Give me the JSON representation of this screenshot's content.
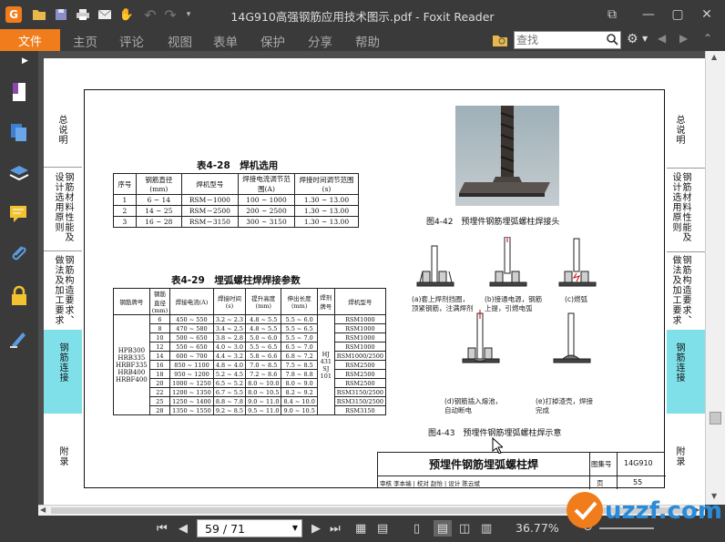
{
  "app": {
    "title": "14G910高强钢筋应用技术图示.pdf - Foxit Reader",
    "colors": {
      "accent": "#f07c1c",
      "chrome": "#3a3a3a",
      "highlight_tab": "#7fe0ea"
    }
  },
  "quick_access": {
    "icons": [
      "foxit-logo-icon",
      "open-folder-icon",
      "save-icon",
      "print-icon",
      "email-icon",
      "hand-tool-icon",
      "undo-icon",
      "redo-icon",
      "customize-icon"
    ]
  },
  "window_controls": {
    "icons": [
      "restore-icon",
      "minimize-icon",
      "maximize-icon",
      "close-icon"
    ]
  },
  "menu": {
    "file": "文件",
    "tabs": [
      "主页",
      "评论",
      "视图",
      "表单",
      "保护",
      "分享",
      "帮助"
    ],
    "search_placeholder": "查找"
  },
  "sidebar": {
    "icons": [
      "expand-panel-icon",
      "bookmark-icon",
      "pages-icon",
      "layers-icon",
      "comments-icon",
      "attachments-icon",
      "security-icon",
      "signature-icon"
    ]
  },
  "document": {
    "left_tabs": [
      "总说明",
      "钢筋材料性能及设计选用原则",
      "钢筋构造要求、做法及加工要求",
      "钢筋连接",
      "附录"
    ],
    "right_tabs": [
      "总说明",
      "钢筋材料性能及设计选用原则",
      "钢筋构造要求、做法及加工要求",
      "钢筋连接",
      "附录"
    ],
    "table28": {
      "caption": "表4-28　焊机选用",
      "headers": [
        "序号",
        "钢筋直径(mm)",
        "焊机型号",
        "焊接电流调节范围(A)",
        "焊接时间调节范围(s)"
      ],
      "rows": [
        [
          "1",
          "6 ~ 14",
          "RSM－1000",
          "100 ~ 1000",
          "1.30 ~ 13.00"
        ],
        [
          "2",
          "14 ~ 25",
          "RSM－2500",
          "200 ~ 2500",
          "1.30 ~ 13.00"
        ],
        [
          "3",
          "16 ~ 28",
          "RSM－3150",
          "300 ~ 3150",
          "1.30 ~ 13.00"
        ]
      ]
    },
    "table29": {
      "caption": "表4-29　埋弧螺柱焊焊接参数",
      "headers": [
        "钢筋牌号",
        "钢筋直径(mm)",
        "焊接电流(A)",
        "焊接时间(s)",
        "提升高度(mm)",
        "伸出长度(mm)",
        "焊剂牌号",
        "焊机型号"
      ],
      "grades": "HPB300 HRB335 HRBF335 HRB400 HRBF400",
      "flux": "HJ 431 SJ 101",
      "rows": [
        [
          "6",
          "450 ~ 550",
          "3.2 ~ 2.3",
          "4.8 ~ 5.5",
          "5.5 ~ 6.0",
          "RSM1000"
        ],
        [
          "8",
          "470 ~ 580",
          "3.4 ~ 2.5",
          "4.8 ~ 5.5",
          "5.5 ~ 6.5",
          "RSM1000"
        ],
        [
          "10",
          "500 ~ 650",
          "3.8 ~ 2.8",
          "5.0 ~ 6.0",
          "5.5 ~ 7.0",
          "RSM1000"
        ],
        [
          "12",
          "550 ~ 650",
          "4.0 ~ 3.0",
          "5.5 ~ 6.5",
          "6.5 ~ 7.0",
          "RSM1000"
        ],
        [
          "14",
          "600 ~ 700",
          "4.4 ~ 3.2",
          "5.8 ~ 6.6",
          "6.8 ~ 7.2",
          "RSM1000/2500"
        ],
        [
          "16",
          "850 ~ 1100",
          "4.8 ~ 4.0",
          "7.0 ~ 8.5",
          "7.5 ~ 8.5",
          "RSM2500"
        ],
        [
          "18",
          "950 ~ 1200",
          "5.2 ~ 4.5",
          "7.2 ~ 8.6",
          "7.8 ~ 8.8",
          "RSM2500"
        ],
        [
          "20",
          "1000 ~ 1250",
          "6.5 ~ 5.2",
          "8.0 ~ 10.0",
          "8.0 ~ 9.0",
          "RSM2500"
        ],
        [
          "22",
          "1200 ~ 1350",
          "6.7 ~ 5.5",
          "8.0 ~ 10.5",
          "8.2 ~ 9.2",
          "RSM3150/2500"
        ],
        [
          "25",
          "1250 ~ 1400",
          "8.8 ~ 7.8",
          "9.0 ~ 11.0",
          "8.4 ~ 10.0",
          "RSM3150/2500"
        ],
        [
          "28",
          "1350 ~ 1550",
          "9.2 ~ 8.5",
          "9.5 ~ 11.0",
          "9.0 ~ 10.5",
          "RSM3150"
        ]
      ]
    },
    "fig42_caption": "图4-42　预埋件钢筋埋弧螺柱焊接头",
    "fig43_caption": "图4-43　预埋件钢筋埋弧螺柱焊示意",
    "steps": [
      "(a)套上焊剂挡圈，顶紧钢筋，注满焊剂",
      "(b)接通电源，钢筋上提，引燃电弧",
      "(c)燃弧",
      "(d)钢筋插入熔池，自动断电",
      "(e)打掉渣壳，焊接完成"
    ],
    "titleblock": {
      "title": "预埋件钢筋埋弧螺柱焊",
      "atlas_label": "图集号",
      "atlas_no": "14G910",
      "page_label": "页",
      "page_no": "55",
      "review_row": "审核 李本端 | 校对 赵怡 | 设计 陈云斌"
    }
  },
  "statusbar": {
    "page": "59 / 71",
    "zoom": "36.77%",
    "nav_icons": [
      "first-page-icon",
      "prev-page-icon",
      "next-page-icon",
      "last-page-icon"
    ],
    "view_icons": [
      "single-page-icon",
      "continuous-icon",
      "facing-icon",
      "continuous-facing-icon",
      "fullscreen-icon"
    ],
    "watermark": "uzzf.com"
  }
}
